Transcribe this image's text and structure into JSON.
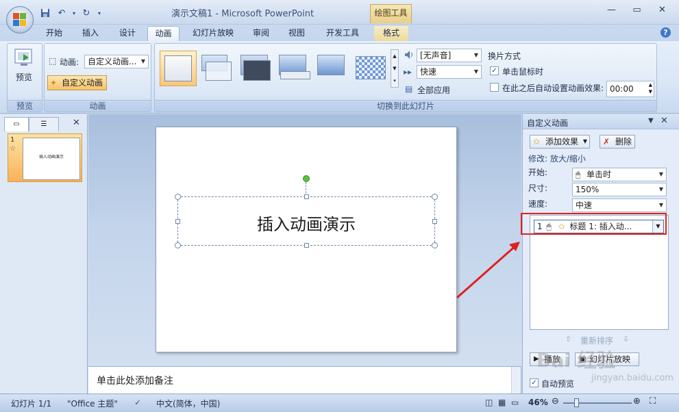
{
  "window": {
    "title": "演示文稿1 - Microsoft PowerPoint",
    "context_tab_title": "绘图工具"
  },
  "qat": {
    "save_icon": "save-icon",
    "undo_icon": "undo-icon",
    "redo_icon": "redo-icon"
  },
  "tabs": [
    "开始",
    "插入",
    "设计",
    "动画",
    "幻灯片放映",
    "审阅",
    "视图",
    "开发工具",
    "格式"
  ],
  "active_tab": "动画",
  "ribbon": {
    "preview": {
      "button_label": "预览",
      "group_label": "预览"
    },
    "animation": {
      "animate_label": "动画:",
      "animate_value": "自定义动画...",
      "custom_button": "自定义动画",
      "group_label": "动画"
    },
    "transition": {
      "sound_value": "[无声音]",
      "speed_value": "快速",
      "apply_all": "全部应用",
      "group_label": "切换到此幻灯片"
    },
    "advance": {
      "heading": "换片方式",
      "on_click_label": "单击鼠标时",
      "on_click_checked": true,
      "auto_label": "在此之后自动设置动画效果:",
      "auto_checked": false,
      "auto_time": "00:00"
    }
  },
  "slides_pane": {
    "slide_number": "1",
    "thumb_text": "插入动画演示"
  },
  "slide": {
    "title_text": "插入动画演示",
    "animation_tag": "1"
  },
  "notes": {
    "placeholder": "单击此处添加备注"
  },
  "task_pane": {
    "title": "自定义动画",
    "add_effect": "添加效果",
    "remove": "删除",
    "modify_label": "修改: 放大/缩小",
    "start_label": "开始:",
    "start_value": "单击时",
    "size_label": "尺寸:",
    "size_value": "150%",
    "speed_label": "速度:",
    "speed_value": "中速",
    "effect_item": {
      "index": "1",
      "text": "标题 1: 插入动..."
    },
    "reorder_label": "重新排序",
    "play_button": "播放",
    "slideshow_button": "幻灯片放映",
    "autopreview_label": "自动预览",
    "autopreview_checked": true
  },
  "statusbar": {
    "slide_info": "幻灯片 1/1",
    "theme": "\"Office 主题\"",
    "language": "中文(简体，中国)",
    "zoom": "46%"
  },
  "watermark": {
    "text": "Bai 经验",
    "url": "jingyan.baidu.com"
  },
  "colors": {
    "highlight_box": "#e0201c",
    "active_button": "#f8c87a"
  }
}
